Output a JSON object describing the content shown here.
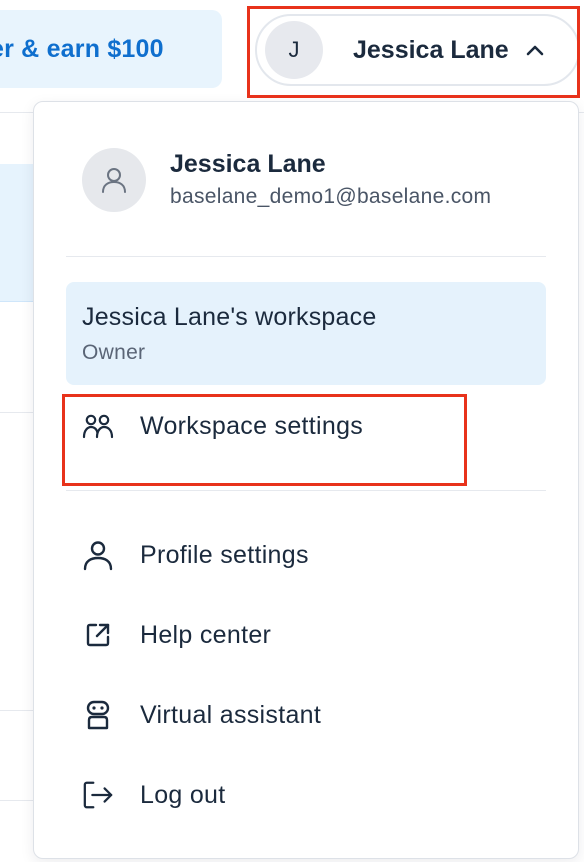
{
  "banner": {
    "text": "er & earn $100"
  },
  "user_pill": {
    "avatar_initial": "J",
    "name": "Jessica Lane"
  },
  "menu": {
    "user": {
      "name": "Jessica Lane",
      "email": "baselane_demo1@baselane.com"
    },
    "workspace": {
      "name": "Jessica Lane's workspace",
      "role": "Owner"
    },
    "items": [
      {
        "label": "Workspace settings",
        "icon": "people-icon"
      },
      {
        "label": "Profile settings",
        "icon": "person-icon"
      },
      {
        "label": "Help center",
        "icon": "external-link-icon"
      },
      {
        "label": "Virtual assistant",
        "icon": "robot-icon"
      },
      {
        "label": "Log out",
        "icon": "logout-icon"
      }
    ]
  },
  "colors": {
    "accent_blue": "#0f6fce",
    "highlight_red": "#e8321b",
    "workspace_bg": "#e5f2fc",
    "text_dark": "#1b2a3d"
  }
}
